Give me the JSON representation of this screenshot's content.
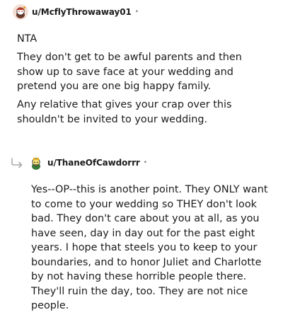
{
  "comments": [
    {
      "author": "u/McflyThrowaway01",
      "separator": "•",
      "avatar_icon": "snoo-avatar-icon",
      "paragraphs": [
        "NTA",
        "They don't get to be awful parents and then show up to save face at your wedding and pretend you are one big happy family.",
        "Any relative that gives your crap over this shouldn't be invited to your wedding."
      ]
    },
    {
      "author": "u/ThaneOfCawdorrr",
      "separator": "•",
      "avatar_icon": "snoo-avatar-icon",
      "reply_icon": "reply-arrow-icon",
      "paragraphs": [
        "Yes--OP--this is another point. They ONLY want to come to your wedding so THEY don't look bad. They don't care about you at all, as you have seen, day in day out for the past eight years. I hope that steels you to keep to your boundaries, and to honor Juliet and Charlotte by not having these horrible people there. They'll ruin the day, too. They are not nice people."
      ]
    }
  ],
  "colors": {
    "text": "#1c1c1c",
    "meta": "#7c7c7c",
    "reply_arrow": "#a8aaab"
  }
}
